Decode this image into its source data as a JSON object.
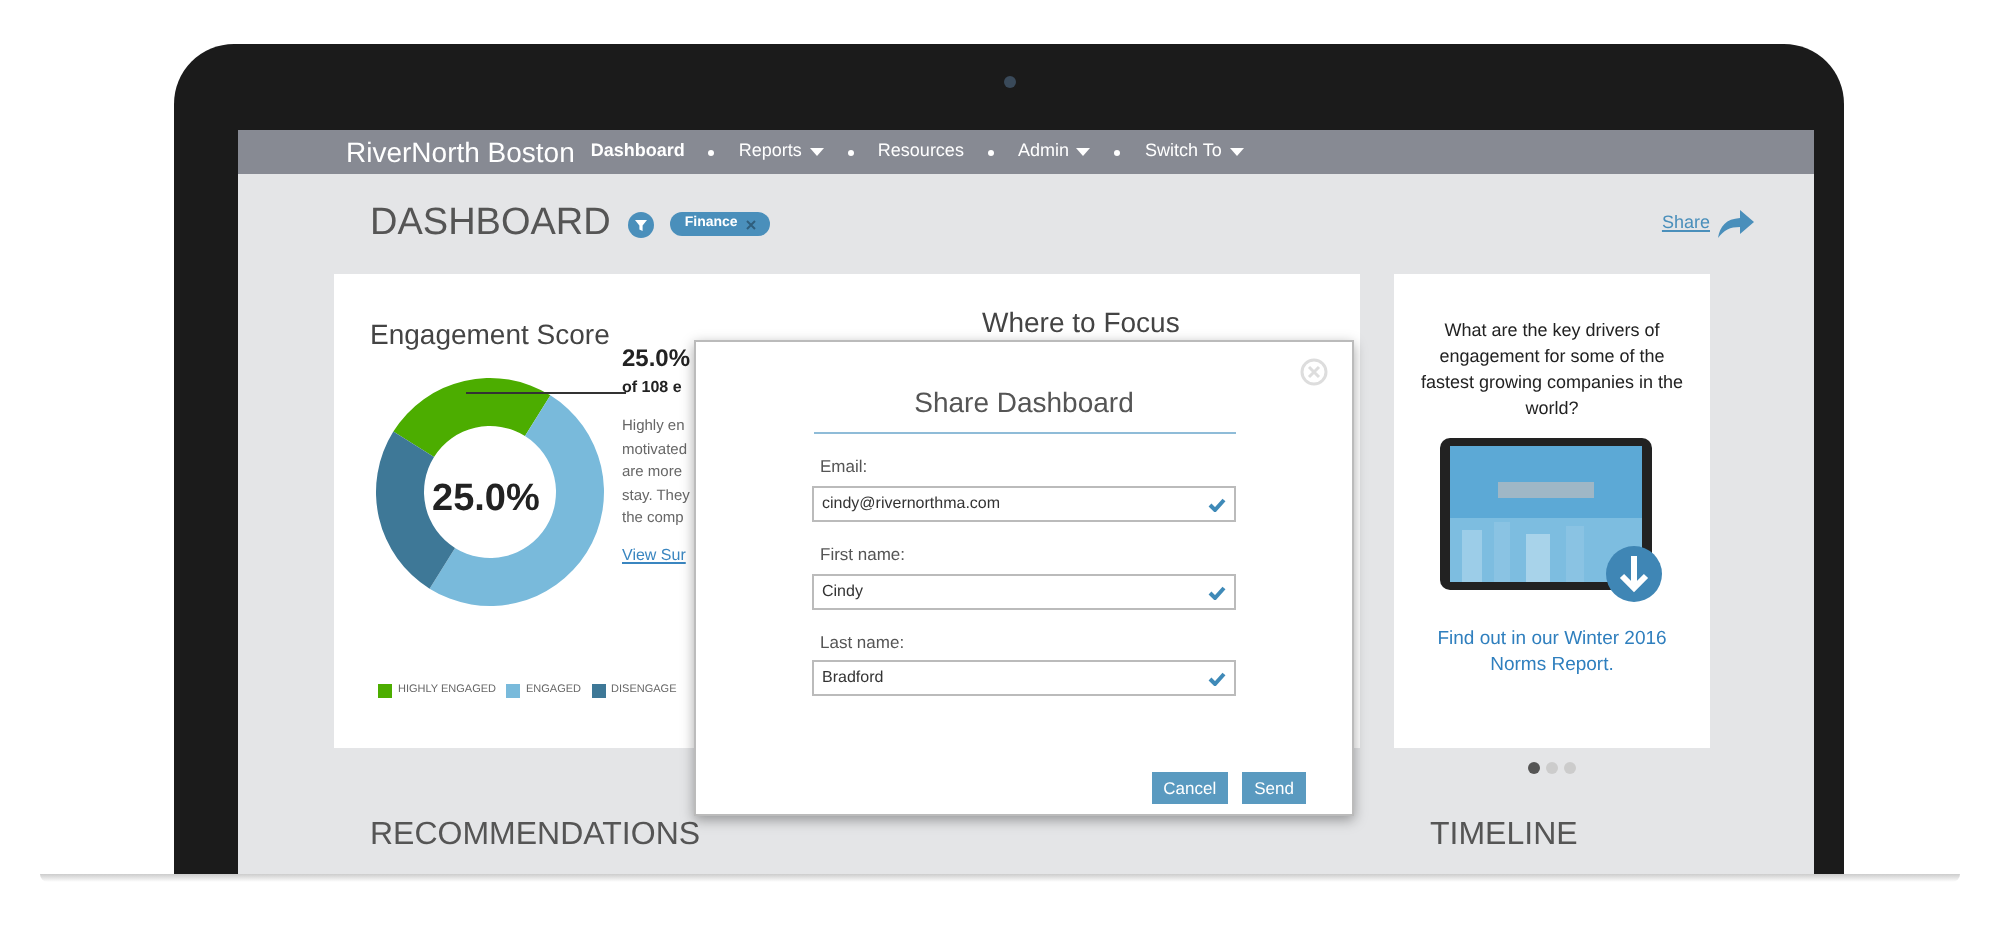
{
  "nav": {
    "brand": "RiverNorth Boston",
    "items": [
      {
        "label": "Dashboard",
        "selected": true,
        "dropdown": false
      },
      {
        "label": "Reports",
        "selected": false,
        "dropdown": true
      },
      {
        "label": "Resources",
        "selected": false,
        "dropdown": false
      },
      {
        "label": "Admin",
        "selected": false,
        "dropdown": true
      },
      {
        "label": "Switch To",
        "selected": false,
        "dropdown": true
      }
    ]
  },
  "page": {
    "title": "DASHBOARD",
    "filter_tag": "Finance",
    "share_link": "Share"
  },
  "engagement": {
    "title": "Engagement Score",
    "center_value": "25.0%",
    "stat": "25.0%",
    "stat_note": "of 108 e",
    "description_lines": [
      "Highly en",
      "motivated",
      "are more",
      "stay. They",
      "the comp"
    ],
    "link": "View Sur",
    "legend": [
      {
        "label": "HIGHLY ENGAGED",
        "color": "#4cad00"
      },
      {
        "label": "ENGAGED",
        "color": "#79badb"
      },
      {
        "label": "DISENGAGE",
        "color": "#3e7897"
      }
    ]
  },
  "focus": {
    "title": "Where to Focus"
  },
  "promo": {
    "question": "What are the key drivers of engagement for some of the fastest growing companies in the world?",
    "link": "Find out in our Winter 2016 Norms Report.",
    "carousel_dots": [
      {
        "selected": true
      },
      {
        "selected": false
      },
      {
        "selected": false
      }
    ]
  },
  "sections": [
    "RECOMMENDATIONS",
    "TIMELINE"
  ],
  "dialog": {
    "title": "Share Dashboard",
    "fields": [
      {
        "label": "Email:",
        "value": "cindy@rivernorthma.com",
        "valid": true
      },
      {
        "label": "First name:",
        "value": "Cindy",
        "valid": true
      },
      {
        "label": "Last name:",
        "value": "Bradford",
        "valid": true
      }
    ],
    "buttons": [
      "Cancel",
      "Send"
    ]
  }
}
